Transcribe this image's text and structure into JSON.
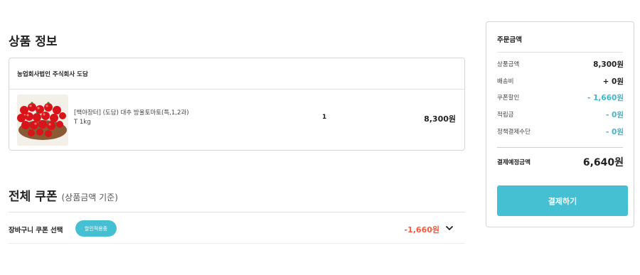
{
  "product_section": {
    "title": "상품 정보",
    "seller": "농업회사법인 주식회사 도담",
    "item": {
      "name": "[백야장터] (도담) 대추 방울토마토(특,1,2과)",
      "option": "T 1kg",
      "quantity": "1",
      "price": "8,300원"
    }
  },
  "coupon_section": {
    "title": "전체 쿠폰",
    "subtitle": "(상품금액 기준)",
    "row_label": "장바구니 쿠폰 선택",
    "badge": "할인적용중",
    "discount": "-1,660원",
    "icon": "chevron-down-icon"
  },
  "summary": {
    "title": "주문금액",
    "lines": [
      {
        "label": "상품금액",
        "value": "8,300원"
      },
      {
        "label": "배송비",
        "value": "+ 0원"
      },
      {
        "label": "쿠폰할인",
        "value": "- 1,660원"
      },
      {
        "label": "적립금",
        "value": "- 0원"
      },
      {
        "label": "정책결제수단",
        "value": "- 0원"
      }
    ],
    "total_label": "결제예정금액",
    "total_value": "6,640원",
    "pay_button": "결제하기"
  },
  "colors": {
    "accent": "#45bfd2",
    "discount_text": "#f25a3e",
    "summary_minus": "#3fb8cc"
  }
}
